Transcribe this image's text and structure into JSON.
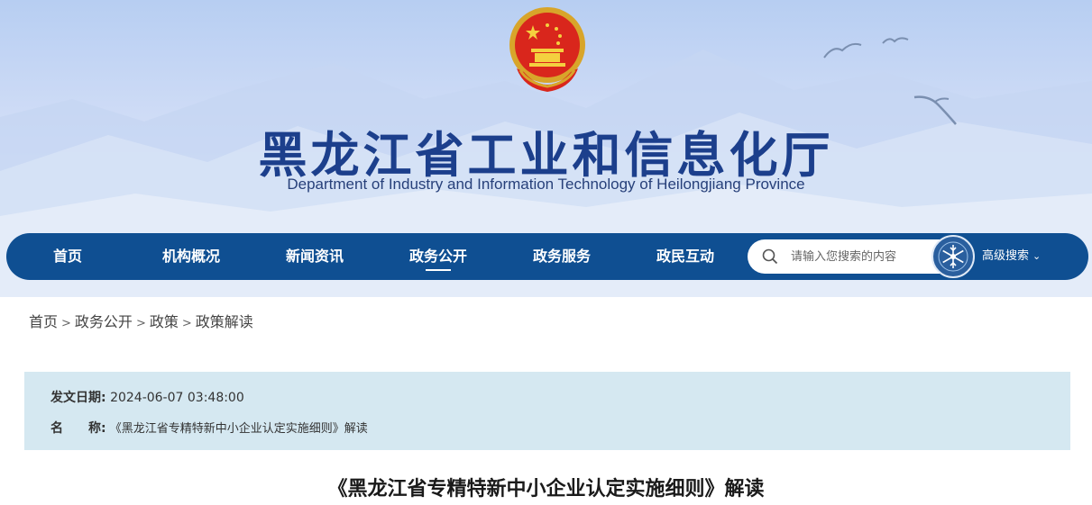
{
  "header": {
    "title": "黑龙江省工业和信息化厅",
    "subtitle": "Department of Industry and Information Technology of Heilongjiang Province",
    "emblem_icon": "national-emblem-icon"
  },
  "nav": {
    "items": [
      {
        "label": "首页"
      },
      {
        "label": "机构概况"
      },
      {
        "label": "新闻资讯"
      },
      {
        "label": "政务公开"
      },
      {
        "label": "政务服务"
      },
      {
        "label": "政民互动"
      }
    ],
    "active_index": 3,
    "search_placeholder": "请输入您搜索的内容",
    "advanced_search_label": "高级搜索"
  },
  "breadcrumb": {
    "items": [
      "首页",
      "政务公开",
      "政策",
      "政策解读"
    ],
    "separator": ">"
  },
  "info": {
    "date_label": "发文日期:",
    "date_value": "2024-06-07 03:48:00",
    "name_label": "名　　称:",
    "name_value": "《黑龙江省专精特新中小企业认定实施细则》解读"
  },
  "article": {
    "title": "《黑龙江省专精特新中小企业认定实施细则》解读"
  },
  "colors": {
    "nav_bg": "#0f4f92",
    "title_blue": "#1c3f8c",
    "info_bg": "#d5e8f1"
  }
}
